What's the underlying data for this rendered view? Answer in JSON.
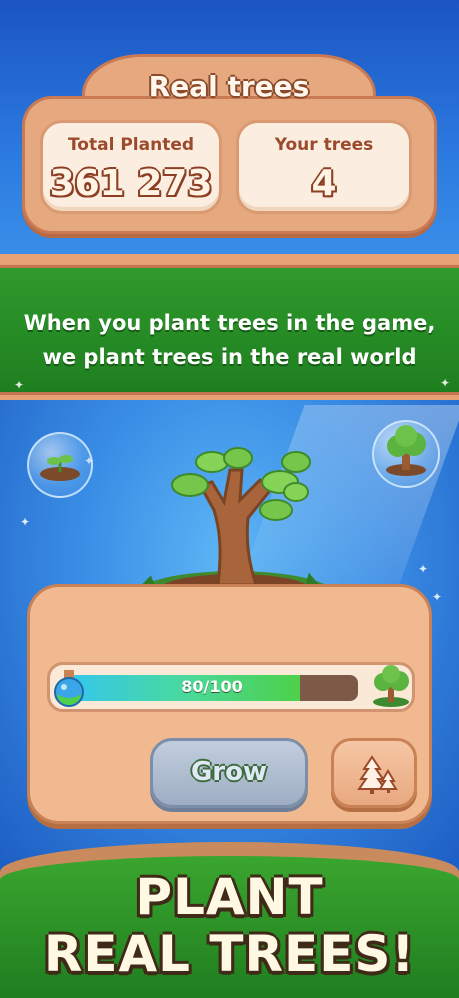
{
  "header": {
    "title": "Real trees",
    "total_planted_label": "Total Planted",
    "total_planted_value": "361 273",
    "your_trees_label": "Your trees",
    "your_trees_value": "4"
  },
  "banner": {
    "line1": "When you plant trees in the game,",
    "line2": "we plant trees in the real world"
  },
  "progress": {
    "text": "80/100",
    "fraction": 0.8,
    "start_icon": "potion-bottle-icon",
    "end_icon": "grown-tree-icon"
  },
  "actions": {
    "grow_label": "Grow",
    "forest_icon": "forest-icon"
  },
  "promo": {
    "line1": "PLANT",
    "line2": "REAL TREES!"
  },
  "colors": {
    "panel": "#e6a87f",
    "banner_green": "#2f9a2c",
    "sky": "#1c5fc7"
  }
}
